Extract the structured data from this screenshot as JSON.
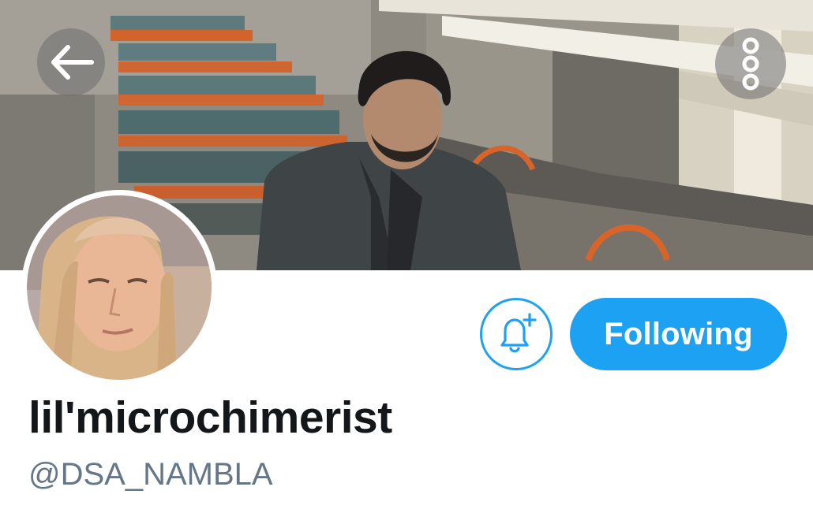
{
  "profile": {
    "display_name": "lil'microchimerist",
    "handle": "@DSA_NAMBLA"
  },
  "header": {
    "back_icon": "arrow-left-icon",
    "more_icon": "more-vertical-icon"
  },
  "actions": {
    "notify_icon": "bell-plus-icon",
    "follow_label": "Following"
  },
  "colors": {
    "accent": "#1da1f2",
    "text_primary": "#14171a",
    "text_secondary": "#657786"
  }
}
